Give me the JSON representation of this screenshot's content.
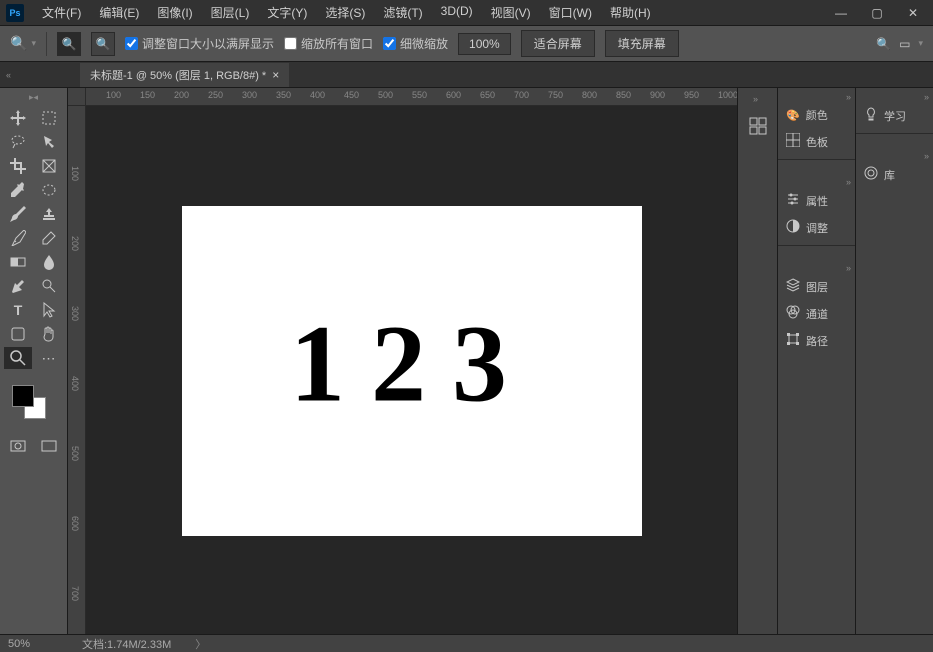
{
  "app": {
    "logo": "Ps"
  },
  "menu": [
    "文件(F)",
    "编辑(E)",
    "图像(I)",
    "图层(L)",
    "文字(Y)",
    "选择(S)",
    "滤镜(T)",
    "3D(D)",
    "视图(V)",
    "窗口(W)",
    "帮助(H)"
  ],
  "window_controls": {
    "minimize": "—",
    "maximize": "▢",
    "close": "✕"
  },
  "options": {
    "resize_to_fit": "调整窗口大小以满屏显示",
    "zoom_all_windows": "缩放所有窗口",
    "scrubby_zoom": "细微缩放",
    "zoom_value": "100%",
    "fit_screen": "适合屏幕",
    "fill_screen": "填充屏幕"
  },
  "tab": {
    "label": "未标题-1 @ 50% (图层 1, RGB/8#) *",
    "close": "×"
  },
  "canvas": {
    "content": "123"
  },
  "ruler_h": [
    "100",
    "150",
    "200",
    "250",
    "300",
    "350",
    "400",
    "450",
    "500",
    "550",
    "600",
    "650",
    "700",
    "750",
    "800",
    "850",
    "900",
    "950",
    "1000"
  ],
  "ruler_v": [
    "100",
    "200",
    "300",
    "400",
    "500",
    "600",
    "700"
  ],
  "panels_center": {
    "g1": [
      "颜色",
      "色板"
    ],
    "g2": [
      "属性",
      "调整"
    ],
    "g3": [
      "图层",
      "通道",
      "路径"
    ]
  },
  "panels_right": {
    "g1": [
      "学习"
    ],
    "g2": [
      "库"
    ]
  },
  "status": {
    "zoom": "50%",
    "doc": "文档:1.74M/2.33M"
  }
}
